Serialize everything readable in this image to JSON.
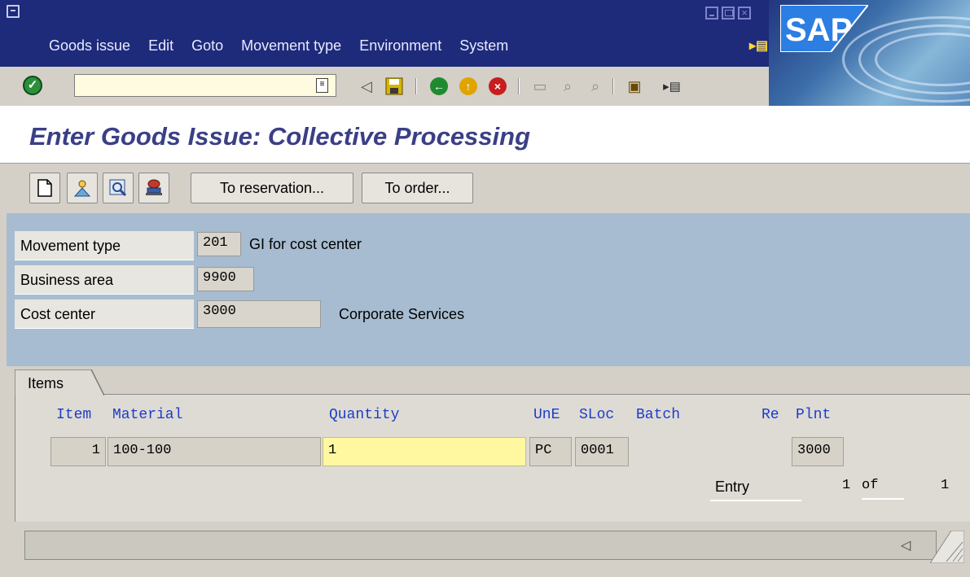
{
  "menu": {
    "items": [
      "Goods issue",
      "Edit",
      "Goto",
      "Movement type",
      "Environment",
      "System"
    ]
  },
  "brand": {
    "logo_text": "SAP"
  },
  "toolbar": {
    "command_value": "",
    "icons": [
      "enter-icon",
      "back-icon",
      "save-icon",
      "back-nav-icon",
      "exit-icon",
      "cancel-icon",
      "print-icon",
      "find-icon",
      "find-next-icon",
      "create-session-icon",
      "layout-icon"
    ]
  },
  "page": {
    "title": "Enter Goods Issue: Collective Processing"
  },
  "app_toolbar": {
    "to_reservation": "To reservation...",
    "to_order": "To order...",
    "icons": [
      "new-item-icon",
      "person-icon",
      "detail-icon",
      "stamp-icon"
    ]
  },
  "header": {
    "movement_type_label": "Movement type",
    "movement_type_value": "201",
    "movement_type_text": "GI for cost center",
    "business_area_label": "Business area",
    "business_area_value": "9900",
    "cost_center_label": "Cost center",
    "cost_center_value": "3000",
    "cost_center_text": "Corporate Services"
  },
  "items": {
    "tab_label": "Items",
    "columns": {
      "item": "Item",
      "material": "Material",
      "quantity": "Quantity",
      "une": "UnE",
      "sloc": "SLoc",
      "batch": "Batch",
      "re": "Re",
      "plnt": "Plnt"
    },
    "rows": [
      {
        "item": "1",
        "material": "100-100",
        "quantity": "1",
        "une": "PC",
        "sloc": "0001",
        "batch": "",
        "plnt": "3000"
      }
    ],
    "entry_label": "Entry",
    "entry_current": "1",
    "entry_of": "of",
    "entry_total": "1"
  },
  "colors": {
    "menubar": "#1e2a7a",
    "title": "#3a3f86",
    "header_bg": "#a7bcd0",
    "column_header": "#1c3dc7",
    "quantity_field": "#fff8a0"
  }
}
